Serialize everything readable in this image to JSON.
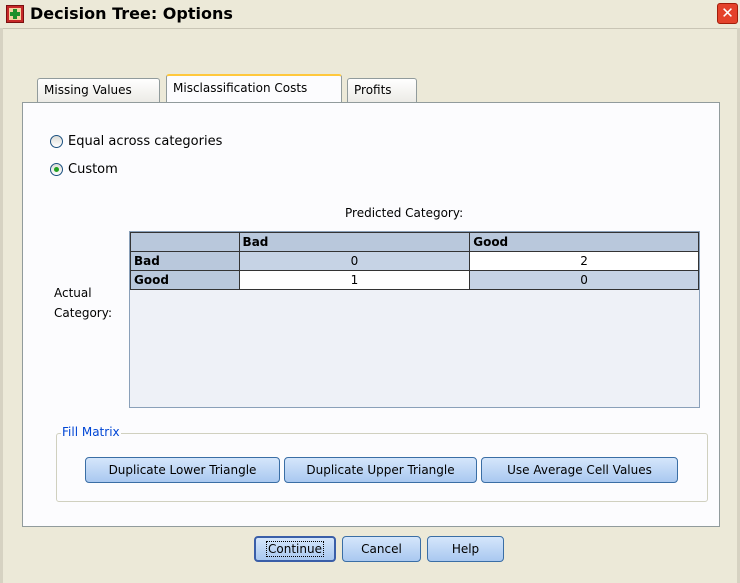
{
  "window": {
    "title": "Decision Tree: Options",
    "close_glyph": "✕"
  },
  "tabs": [
    {
      "label": "Missing Values",
      "active": false
    },
    {
      "label": "Misclassification Costs",
      "active": true
    },
    {
      "label": "Profits",
      "active": false
    }
  ],
  "costs": {
    "option_equal": "Equal across categories",
    "option_custom": "Custom",
    "selected": "Custom",
    "predicted_label": "Predicted Category:",
    "actual_label_line1": "Actual",
    "actual_label_line2": "Category:",
    "columns": [
      "Bad",
      "Good"
    ],
    "rows": [
      {
        "label": "Bad",
        "values": [
          "0",
          "2"
        ]
      },
      {
        "label": "Good",
        "values": [
          "1",
          "0"
        ]
      }
    ]
  },
  "fill_matrix": {
    "legend": "Fill Matrix",
    "dup_lower": "Duplicate Lower Triangle",
    "dup_upper": "Duplicate Upper Triangle",
    "use_average": "Use Average Cell Values"
  },
  "footer": {
    "continue": "Continue",
    "cancel": "Cancel",
    "help": "Help"
  },
  "colors": {
    "dialog_bg": "#ece9d8",
    "panel_bg": "#fcfcfe",
    "header_cell": "#b9c8dc",
    "radio_dot": "#21a121",
    "close_button": "#e4422b"
  }
}
